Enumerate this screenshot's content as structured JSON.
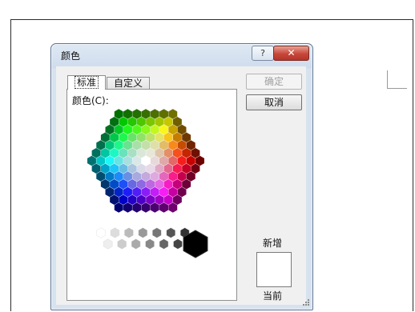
{
  "dialog": {
    "title": "颜色",
    "help": "?",
    "close": "✕"
  },
  "tabs": {
    "standard": "标准",
    "custom": "自定义"
  },
  "panel": {
    "colors_label": "颜色(C):"
  },
  "buttons": {
    "ok": "确定",
    "cancel": "取消"
  },
  "preview": {
    "new_label": "新增",
    "current_label": "当前"
  },
  "state": {
    "active_tab": "standard",
    "ok_enabled": false
  }
}
